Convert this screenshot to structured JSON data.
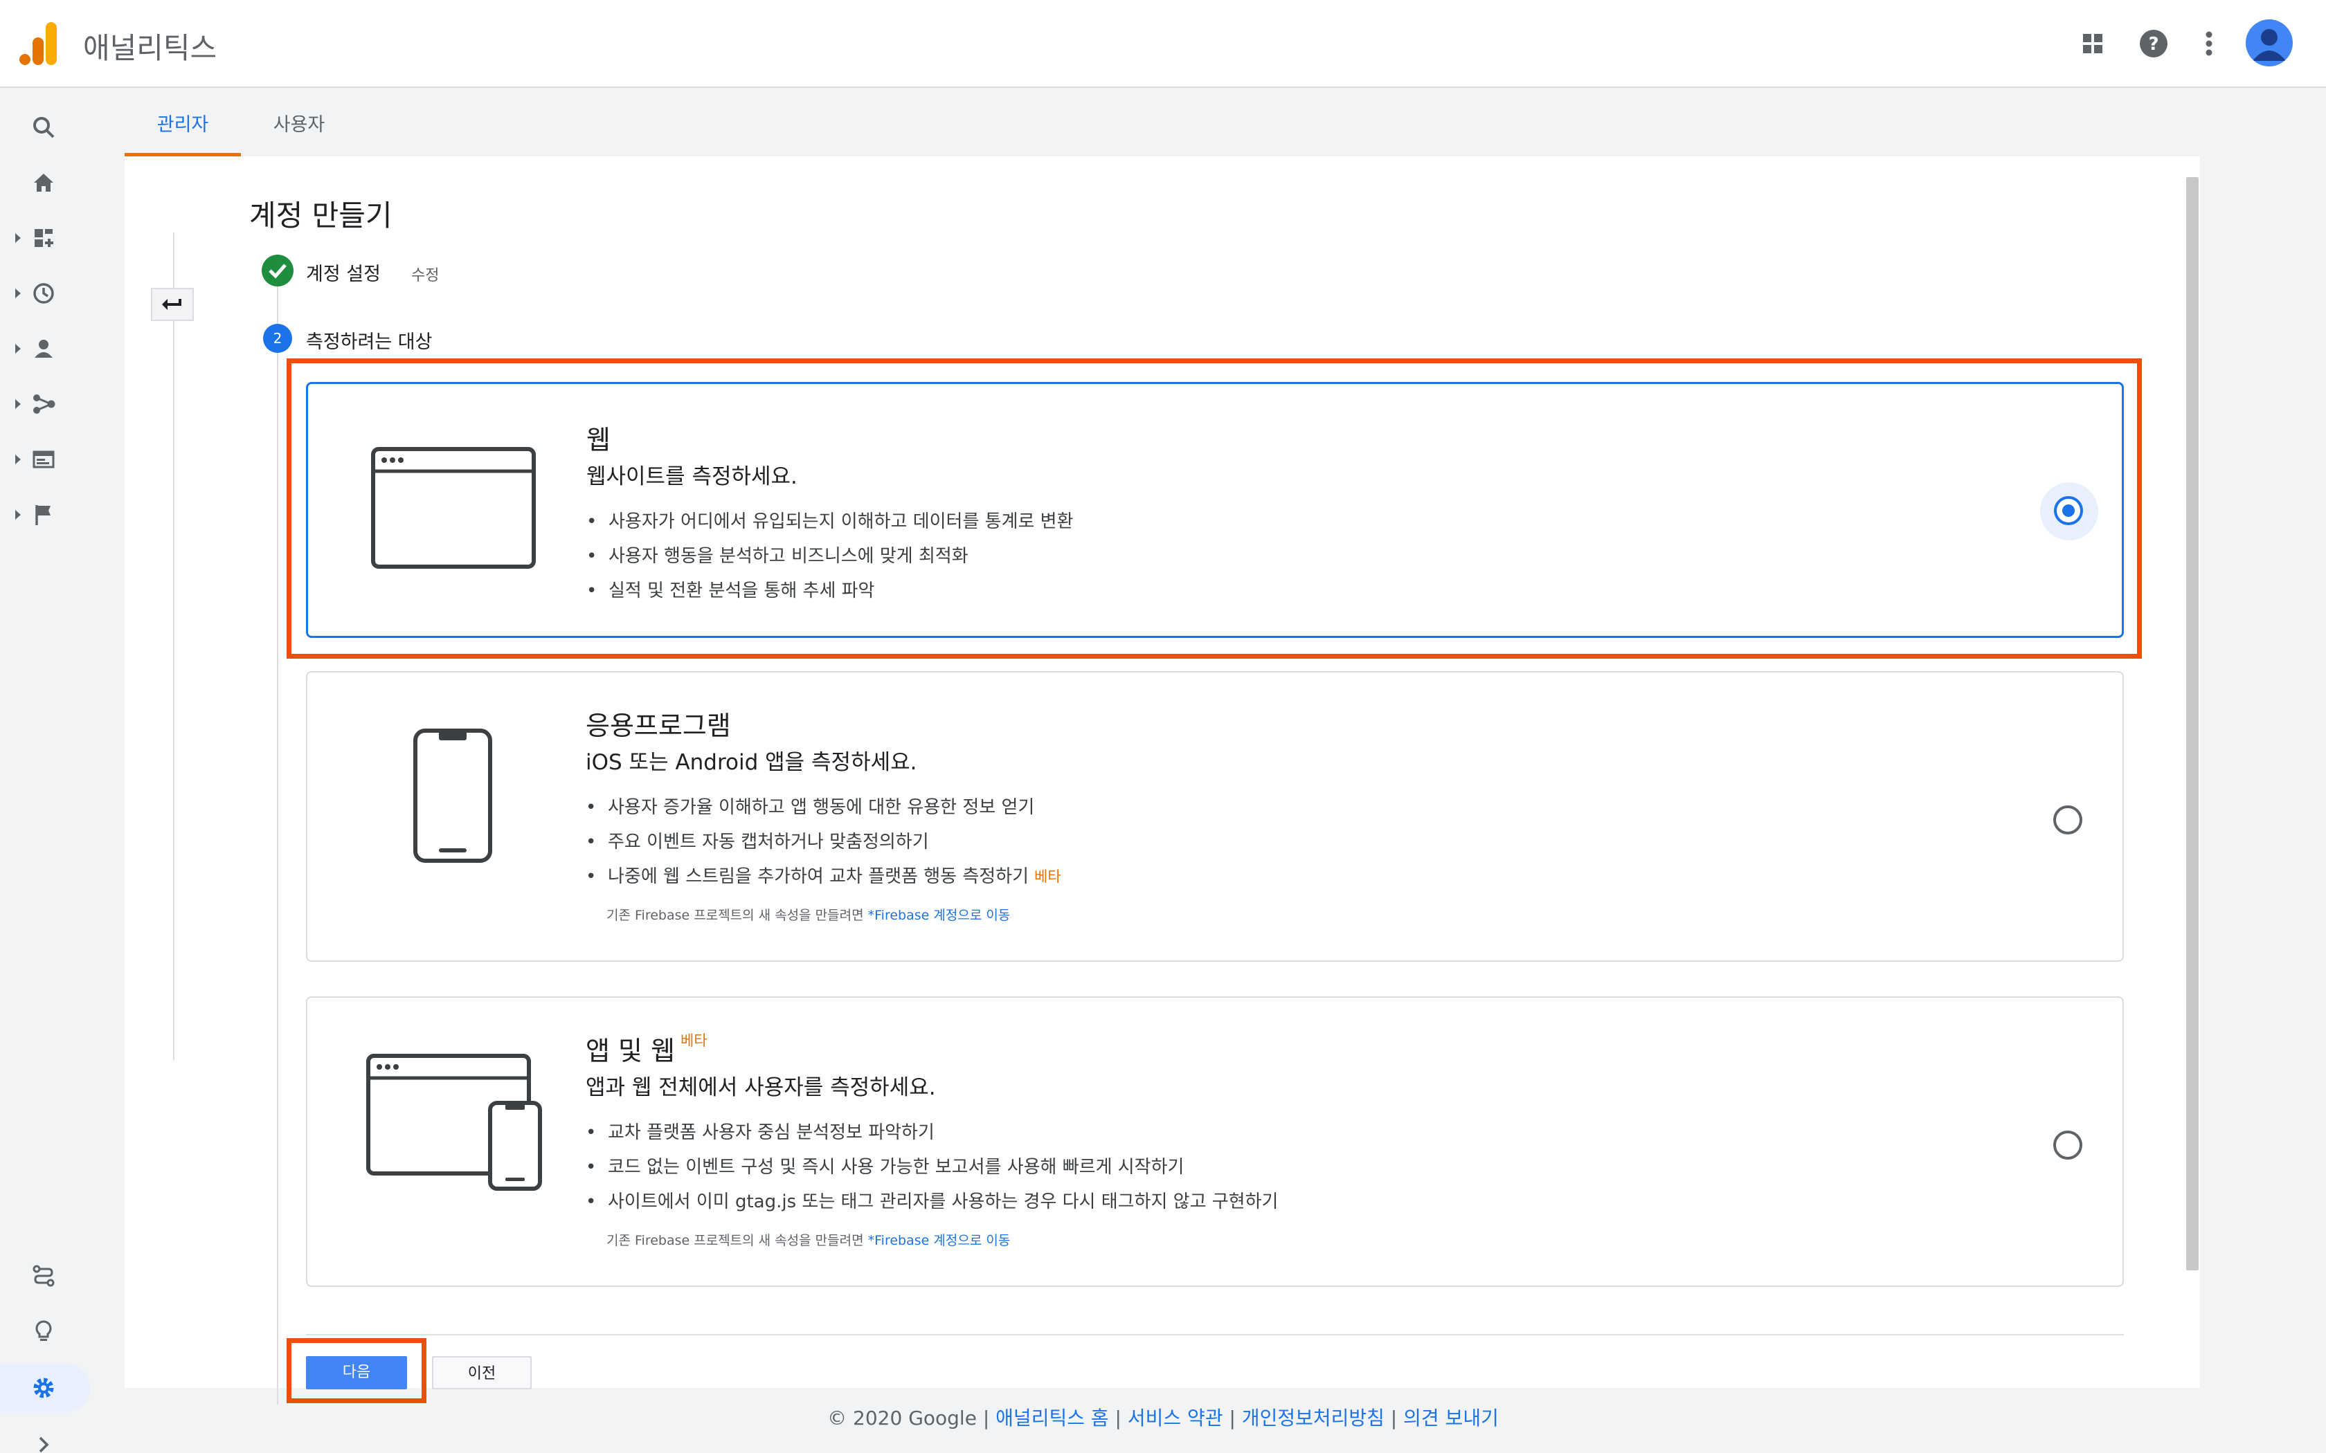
{
  "header": {
    "app_title": "애널리틱스",
    "icons": [
      "apps-grid-icon",
      "help-icon",
      "more-vert-icon",
      "account-icon"
    ]
  },
  "left_nav": {
    "items": [
      "search-icon",
      "home-icon",
      "customization-icon",
      "realtime-icon",
      "audience-icon",
      "acquisition-icon",
      "behavior-icon",
      "conversions-icon",
      "attribution-icon",
      "insights-icon",
      "admin-gear-icon",
      "expand-icon"
    ],
    "active": "admin-gear-icon"
  },
  "tabs": [
    {
      "label": "관리자",
      "active": true
    },
    {
      "label": "사용자",
      "active": false
    }
  ],
  "page": {
    "title": "계정 만들기",
    "step1": {
      "label": "계정 설정",
      "edit": "수정"
    },
    "step2": {
      "number": "2",
      "label": "측정하려는 대상"
    }
  },
  "options": {
    "web": {
      "title": "웹",
      "subtitle": "웹사이트를 측정하세요.",
      "bullets": [
        "사용자가 어디에서 유입되는지 이해하고 데이터를 통계로 변환",
        "사용자 행동을 분석하고 비즈니스에 맞게 최적화",
        "실적 및 전환 분석을 통해 추세 파악"
      ],
      "selected": true
    },
    "app": {
      "title": "응용프로그램",
      "subtitle": "iOS 또는 Android 앱을 측정하세요.",
      "bullets": [
        "사용자 증가율 이해하고 앱 행동에 대한 유용한 정보 얻기",
        "주요 이벤트 자동 캡처하거나 맞춤정의하기",
        "나중에 웹 스트림을 추가하여 교차 플랫폼 행동 측정하기"
      ],
      "beta": "베타",
      "note": "기존 Firebase 프로젝트의 새 속성을 만들려면 ",
      "note_link": "*Firebase 계정으로 이동",
      "selected": false
    },
    "appweb": {
      "title": "앱 및 웹",
      "beta": "베타",
      "subtitle": "앱과 웹 전체에서 사용자를 측정하세요.",
      "bullets": [
        "교차 플랫폼 사용자 중심 분석정보 파악하기",
        "코드 없는 이벤트 구성 및 즉시 사용 가능한 보고서를 사용해 빠르게 시작하기",
        "사이트에서 이미 gtag.js 또는 태그 관리자를 사용하는 경우 다시 태그하지 않고 구현하기"
      ],
      "note": "기존 Firebase 프로젝트의 새 속성을 만들려면 ",
      "note_link": "*Firebase 계정으로 이동",
      "selected": false
    }
  },
  "buttons": {
    "next": "다음",
    "prev": "이전"
  },
  "footer": {
    "copyright": "© 2020 Google | ",
    "links": [
      "애널리틱스 홈",
      "서비스 약관",
      "개인정보처리방침",
      "의견 보내기"
    ],
    "sep": " | "
  },
  "colors": {
    "accent": "#1a73e8",
    "highlight": "#e8510a",
    "beta": "#e8710a",
    "success": "#1e8e3e"
  }
}
